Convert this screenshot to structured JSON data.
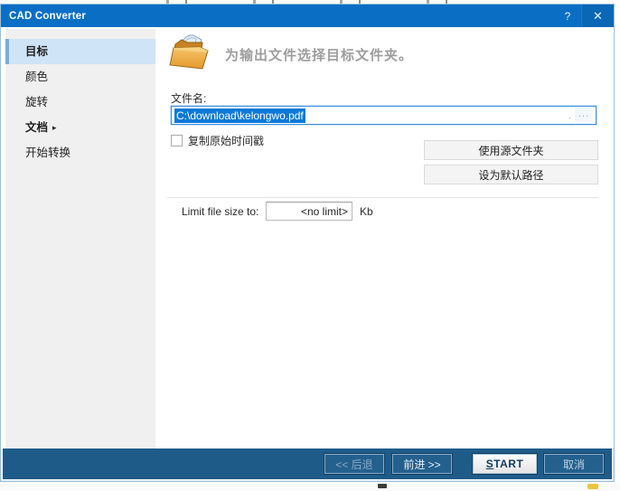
{
  "window": {
    "title": "CAD Converter",
    "help_label": "?",
    "close_label": "✕"
  },
  "sidebar": {
    "items": [
      {
        "label": "目标"
      },
      {
        "label": "颜色"
      },
      {
        "label": "旋转"
      },
      {
        "label": "文档",
        "arrow": "▸"
      },
      {
        "label": "开始转换"
      }
    ]
  },
  "main": {
    "header": {
      "text": "为输出文件选择目标文件夹。"
    },
    "filename": {
      "label": "文件名:",
      "value": "C:\\download\\kelongwo.pdf",
      "dot_label": ".",
      "browse_label": "..."
    },
    "timestamp_checkbox": {
      "label": "复制原始时间戳",
      "checked": false
    },
    "buttons": {
      "use_source_folder": "使用源文件夹",
      "set_default_path": "设为默认路径"
    },
    "limit": {
      "label": "Limit file size to:",
      "value": "<no limit>",
      "unit": "Kb"
    }
  },
  "footer": {
    "back": "<< 后退",
    "forward": "前进 >>",
    "start_accesskey": "S",
    "start_rest": "TART",
    "cancel": "取消"
  }
}
